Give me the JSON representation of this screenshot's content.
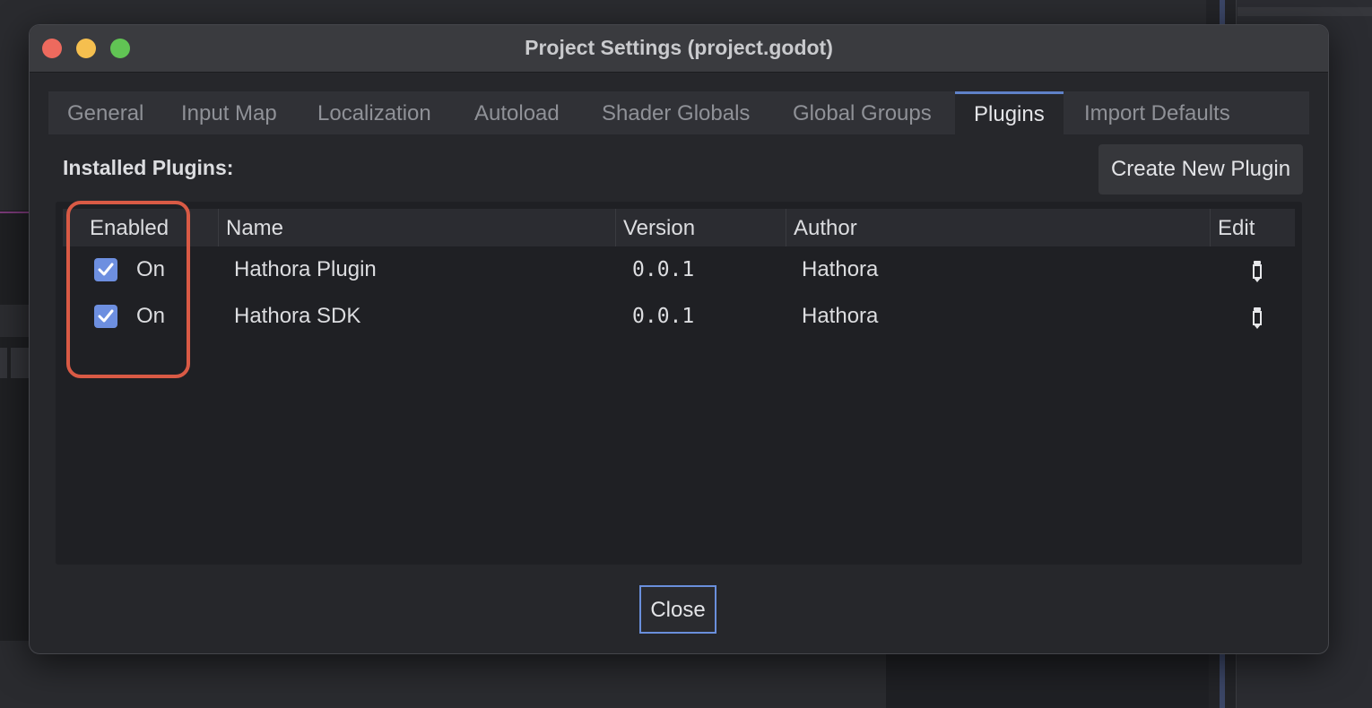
{
  "window": {
    "title": "Project Settings (project.godot)"
  },
  "tabs": [
    {
      "label": "General"
    },
    {
      "label": "Input Map"
    },
    {
      "label": "Localization"
    },
    {
      "label": "Autoload"
    },
    {
      "label": "Shader Globals"
    },
    {
      "label": "Global Groups"
    },
    {
      "label": "Plugins",
      "active": true
    },
    {
      "label": "Import Defaults"
    }
  ],
  "plugins_panel": {
    "heading": "Installed Plugins:",
    "create_button": "Create New Plugin",
    "columns": {
      "enabled": "Enabled",
      "name": "Name",
      "version": "Version",
      "author": "Author",
      "edit": "Edit"
    },
    "rows": [
      {
        "enabled": true,
        "status": "On",
        "name": "Hathora Plugin",
        "version": "0.0.1",
        "author": "Hathora",
        "edit_icon": "edit-pencil-icon"
      },
      {
        "enabled": true,
        "status": "On",
        "name": "Hathora SDK",
        "version": "0.0.1",
        "author": "Hathora",
        "edit_icon": "edit-pencil-icon"
      }
    ]
  },
  "footer": {
    "close_button": "Close"
  },
  "colors": {
    "accent": "#6d8fe0",
    "highlight": "#d95a45"
  }
}
